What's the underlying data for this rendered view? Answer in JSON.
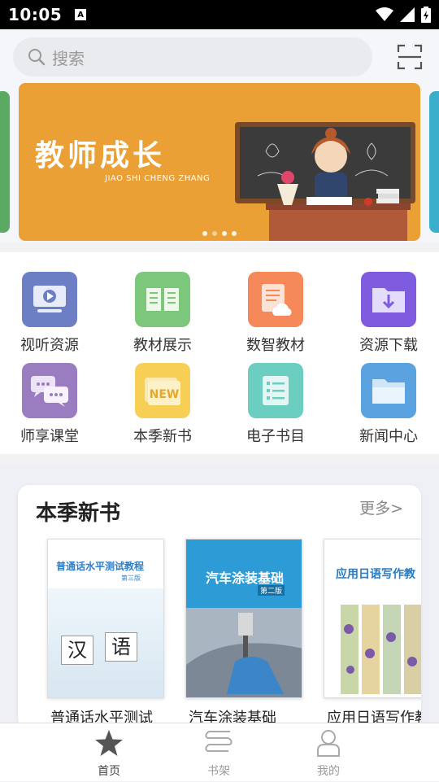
{
  "status": {
    "time": "10:05",
    "notification_glyph": "A"
  },
  "search": {
    "placeholder": "搜索"
  },
  "banner": {
    "title": "教师成长",
    "subtitle": "JIAO SHI CHENG ZHANG",
    "active_dot": 2,
    "dot_count": 4,
    "color": "#eba035"
  },
  "grid": {
    "items": [
      {
        "label": "视听资源",
        "icon": "video-icon",
        "color": "#6c7fc4"
      },
      {
        "label": "教材展示",
        "icon": "open-book-icon",
        "color": "#7dc77c"
      },
      {
        "label": "数智教材",
        "icon": "cloud-document-icon",
        "color": "#f5895a"
      },
      {
        "label": "资源下载",
        "icon": "download-folder-icon",
        "color": "#7f5be0"
      },
      {
        "label": "师享课堂",
        "icon": "chat-bubbles-icon",
        "color": "#9a7cc0"
      },
      {
        "label": "本季新书",
        "icon": "new-badge-icon",
        "color": "#f7cf55"
      },
      {
        "label": "电子书目",
        "icon": "list-icon",
        "color": "#6ccdc1"
      },
      {
        "label": "新闻中心",
        "icon": "folder-icon",
        "color": "#5aa3e0"
      }
    ]
  },
  "new_books": {
    "title": "本季新书",
    "more": "更多>",
    "books": [
      {
        "name": "普通话水平测试",
        "cover_title": "普通话水平测试教程",
        "cover_edition": "第三版",
        "cover_chars": [
          "汉",
          "语"
        ]
      },
      {
        "name": "汽车涂装基础",
        "cover_title": "汽车涂装基础",
        "cover_edition": "第二版"
      },
      {
        "name": "应用日语写作教",
        "cover_title": "应用日语写作教"
      }
    ]
  },
  "bottom_nav": {
    "items": [
      {
        "label": "首页",
        "icon": "star-icon",
        "active": true
      },
      {
        "label": "书架",
        "icon": "bookshelf-icon",
        "active": false
      },
      {
        "label": "我的",
        "icon": "profile-icon",
        "active": false
      }
    ]
  }
}
